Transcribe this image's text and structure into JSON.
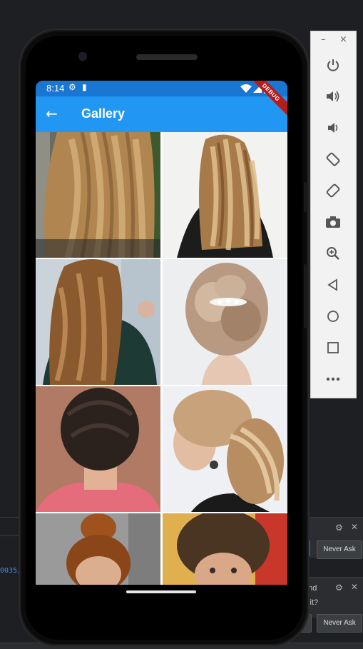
{
  "ide": {
    "code_fragment": "0035/",
    "toast_text_1": "and",
    "toast_text_2": "y it?",
    "btn_never_ask_1": "Never Ask",
    "btn_never_ask_2": "Never Ask",
    "btn_partial": "w"
  },
  "status_bar": {
    "time": "8:14",
    "icons": [
      "settings-gear-icon",
      "sd-card-icon",
      "wifi-icon",
      "signal-icon",
      "battery-icon"
    ]
  },
  "app_bar": {
    "back_icon": "arrow-back-icon",
    "title": "Gallery",
    "debug_banner": "DEBUG"
  },
  "gallery": {
    "images": [
      {
        "name": "gallery-image-1",
        "desc": "long wavy blonde hair"
      },
      {
        "name": "gallery-image-2",
        "desc": "long wavy balayage hair"
      },
      {
        "name": "gallery-image-3",
        "desc": "half-up curly hair"
      },
      {
        "name": "gallery-image-4",
        "desc": "updo with hair clip"
      },
      {
        "name": "gallery-image-5",
        "desc": "short pixie cut"
      },
      {
        "name": "gallery-image-6",
        "desc": "curly ponytail"
      },
      {
        "name": "gallery-image-7",
        "desc": "messy bun"
      },
      {
        "name": "gallery-image-8",
        "desc": "short curly hair"
      }
    ]
  },
  "emulator_toolbar": {
    "minimize": "–",
    "close": "×",
    "buttons": [
      "power-icon",
      "volume-up-icon",
      "volume-down-icon",
      "rotate-left-icon",
      "rotate-right-icon",
      "camera-icon",
      "zoom-icon",
      "back-icon",
      "home-icon",
      "overview-icon",
      "more-icon"
    ]
  }
}
